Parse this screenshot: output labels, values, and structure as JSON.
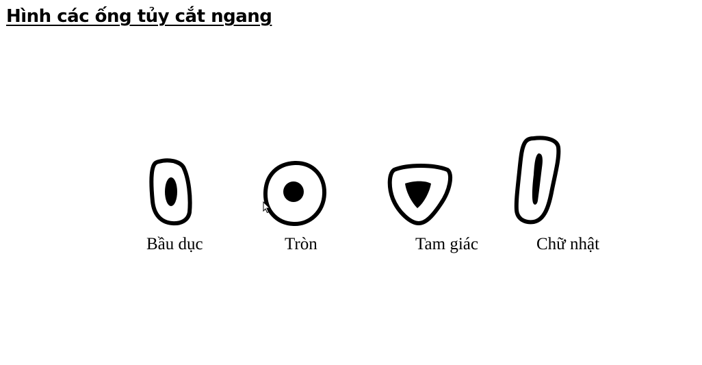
{
  "title": "Hình các ống tủy cắt ngang",
  "figures": [
    {
      "id": "oval",
      "label": "Bầu dục",
      "icon": "oval-canal-icon"
    },
    {
      "id": "round",
      "label": "Tròn",
      "icon": "round-canal-icon"
    },
    {
      "id": "triangle",
      "label": "Tam giác",
      "icon": "triangular-canal-icon"
    },
    {
      "id": "rectangle",
      "label": "Chữ nhật",
      "icon": "rectangular-canal-icon"
    }
  ],
  "colors": {
    "ink": "#000000",
    "background": "#ffffff"
  }
}
